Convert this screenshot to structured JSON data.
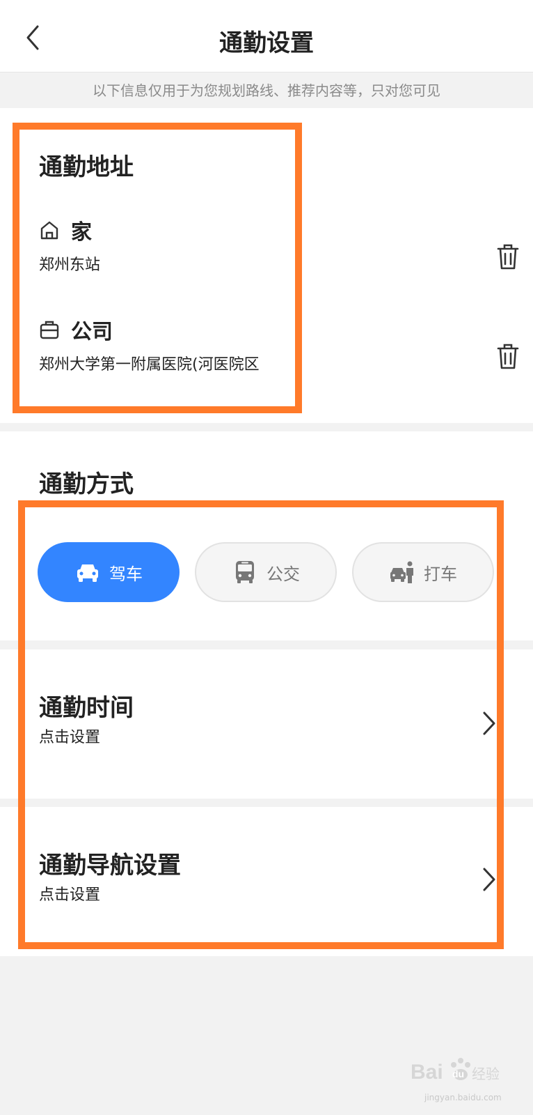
{
  "header": {
    "title": "通勤设置"
  },
  "notice": "以下信息仅用于为您规划路线、推荐内容等，只对您可见",
  "address_section": {
    "title": "通勤地址",
    "home": {
      "label": "家",
      "value": "郑州东站"
    },
    "work": {
      "label": "公司",
      "value": "郑州大学第一附属医院(河医院区"
    }
  },
  "mode_section": {
    "title": "通勤方式",
    "options": [
      {
        "label": "驾车",
        "selected": true
      },
      {
        "label": "公交",
        "selected": false
      },
      {
        "label": "打车",
        "selected": false
      }
    ]
  },
  "time_row": {
    "title": "通勤时间",
    "subtitle": "点击设置"
  },
  "nav_row": {
    "title": "通勤导航设置",
    "subtitle": "点击设置"
  },
  "colors": {
    "accent": "#3385ff",
    "highlight": "#ff7a2a",
    "background": "#f2f2f2"
  },
  "watermark": {
    "text": "jingyan.baidu.com"
  }
}
